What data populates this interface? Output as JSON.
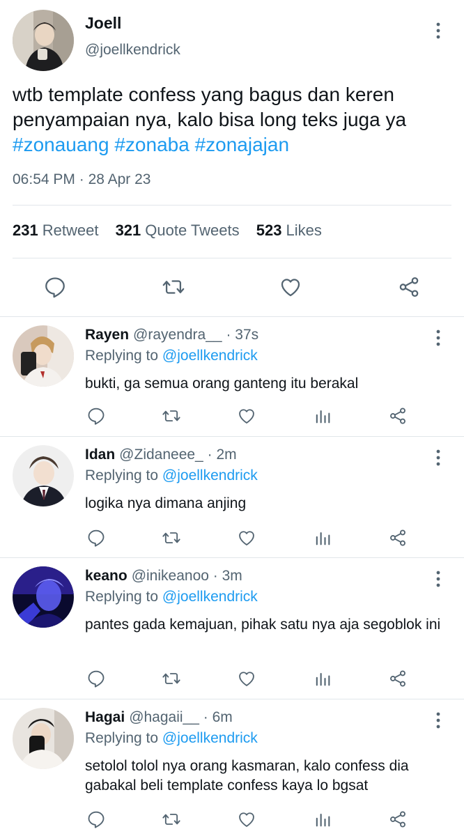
{
  "colors": {
    "text": "#0f1419",
    "secondary": "#536471",
    "link": "#1d9bf0",
    "divider": "#e1e6ea"
  },
  "tweet": {
    "author_name": "Joell",
    "author_handle": "@joellkendrick",
    "text_lines": [
      "wtb template confess yang bagus dan keren",
      "penyampaian nya, kalo bisa long teks juga ya"
    ],
    "hashtags": [
      "#zonauang",
      "#zonaba",
      "#zonajajan"
    ],
    "time": "06:54 PM",
    "date_sep": " · ",
    "date": "28 Apr 23",
    "stats": {
      "retweets": "231",
      "retweets_label": "Retweet",
      "quotes": "321",
      "quotes_label": "Quote Tweets",
      "likes": "523",
      "likes_label": "Likes"
    },
    "actions": [
      "reply-icon",
      "retweet-icon",
      "like-icon",
      "share-icon"
    ]
  },
  "replies": [
    {
      "name": "Rayen",
      "handle": "@rayendra__",
      "sep": "·",
      "time": "37s",
      "replying_label": "Replying to",
      "replying_to": "@joellkendrick",
      "text": "bukti, ga semua orang ganteng itu berakal"
    },
    {
      "name": "Idan",
      "handle": "@Zidaneee_",
      "sep": "·",
      "time": "2m",
      "replying_label": "Replying to",
      "replying_to": "@joellkendrick",
      "text": "logika nya dimana anjing"
    },
    {
      "name": "keano",
      "handle": "@inikeanoo",
      "sep": "·",
      "time": "3m",
      "replying_label": "Replying to",
      "replying_to": "@joellkendrick",
      "text": "pantes gada kemajuan, pihak satu nya aja segoblok ini"
    },
    {
      "name": "Hagai",
      "handle": "@hagaii__",
      "sep": "·",
      "time": "6m",
      "replying_label": "Replying to",
      "replying_to": "@joellkendrick",
      "text": "setolol tolol nya orang kasmaran, kalo confess dia gabakal beli template confess kaya lo bgsat"
    }
  ],
  "reply_actions": [
    "reply-icon",
    "retweet-icon",
    "like-icon",
    "analytics-icon",
    "share-icon"
  ]
}
